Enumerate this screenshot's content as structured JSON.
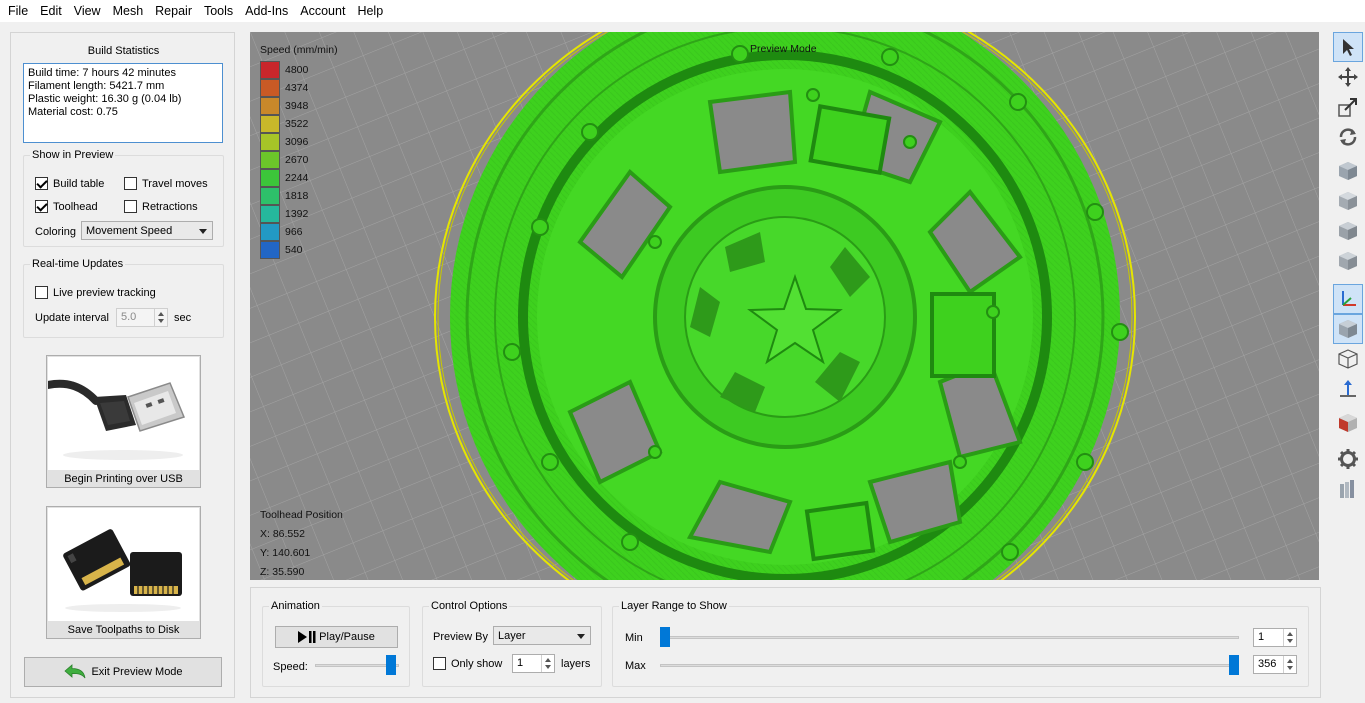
{
  "menu": [
    "File",
    "Edit",
    "View",
    "Mesh",
    "Repair",
    "Tools",
    "Add-Ins",
    "Account",
    "Help"
  ],
  "build_stats": {
    "title": "Build Statistics",
    "lines": [
      "Build time: 7 hours 42 minutes",
      "Filament length: 5421.7 mm",
      "Plastic weight: 16.30 g (0.04 lb)",
      "Material cost: 0.75"
    ]
  },
  "show_in_preview": {
    "title": "Show in Preview",
    "build_table": {
      "label": "Build table",
      "checked": true
    },
    "travel_moves": {
      "label": "Travel moves",
      "checked": false
    },
    "toolhead": {
      "label": "Toolhead",
      "checked": true
    },
    "retractions": {
      "label": "Retractions",
      "checked": false
    },
    "coloring_label": "Coloring",
    "coloring_value": "Movement Speed"
  },
  "realtime": {
    "title": "Real-time Updates",
    "live_label": "Live preview tracking",
    "live_checked": false,
    "interval_label": "Update interval",
    "interval_value": "5.0",
    "interval_unit": "sec"
  },
  "usb_button": {
    "label": "Begin Printing over USB"
  },
  "disk_button": {
    "label": "Save Toolpaths to Disk"
  },
  "exit_button": {
    "label": "Exit Preview Mode"
  },
  "viewport": {
    "mode": "Preview Mode",
    "legend_title": "Speed (mm/min)",
    "legend": [
      {
        "value": "4800",
        "color": "#c8262b"
      },
      {
        "value": "4374",
        "color": "#c85a25"
      },
      {
        "value": "3948",
        "color": "#c8882a"
      },
      {
        "value": "3522",
        "color": "#c8b82a"
      },
      {
        "value": "3096",
        "color": "#a6c428"
      },
      {
        "value": "2670",
        "color": "#6cc42a"
      },
      {
        "value": "2244",
        "color": "#3cc63a"
      },
      {
        "value": "1818",
        "color": "#2ec06a"
      },
      {
        "value": "1392",
        "color": "#25b89c"
      },
      {
        "value": "966",
        "color": "#2299c4"
      },
      {
        "value": "540",
        "color": "#2266c4"
      }
    ],
    "toolhead_title": "Toolhead Position",
    "x_label": "X: 86.552",
    "y_label": "Y: 140.601",
    "z_label": "Z: 35.590"
  },
  "animation": {
    "title": "Animation",
    "play_label": "Play/Pause",
    "speed_label": "Speed:",
    "speed_fraction": 0.9
  },
  "control": {
    "title": "Control Options",
    "preview_by_label": "Preview By",
    "preview_by_value": "Layer",
    "only_show_label": "Only show",
    "only_show_checked": false,
    "layers_value": "1",
    "layers_label": "layers"
  },
  "layer_range": {
    "title": "Layer Range to Show",
    "min_label": "Min",
    "min_value": "1",
    "max_label": "Max",
    "max_value": "356",
    "total_layers": 356
  },
  "colors": {
    "accent": "#0078d7",
    "model_green": "#3ed11e",
    "bed_gray": "#8a8a8a"
  }
}
